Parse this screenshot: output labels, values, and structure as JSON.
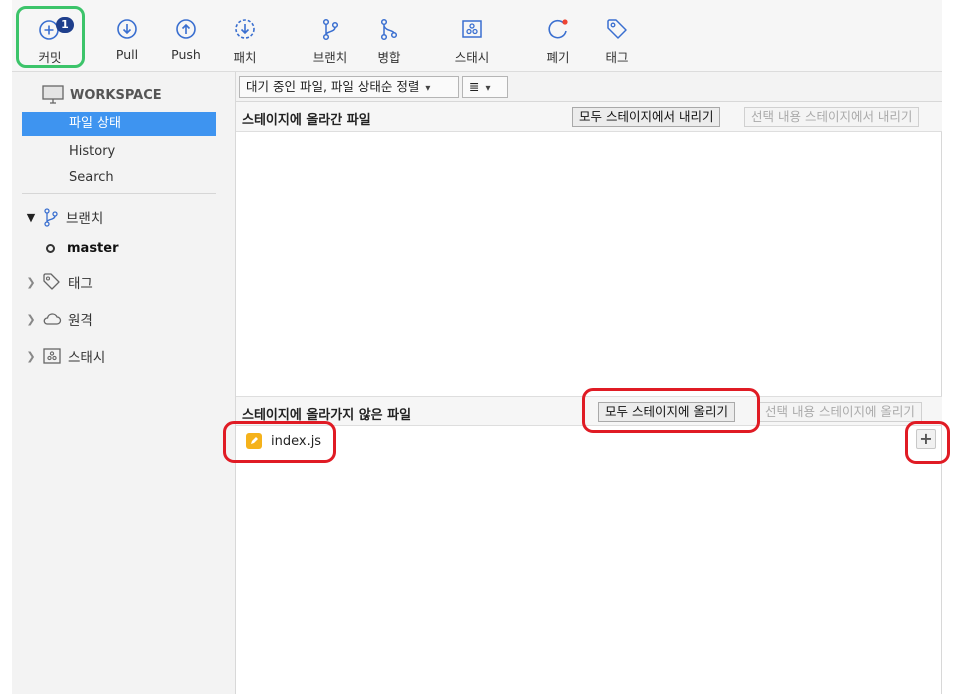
{
  "toolbar": {
    "commit": {
      "label": "커밋",
      "badge": "1"
    },
    "pull": {
      "label": "Pull"
    },
    "push": {
      "label": "Push"
    },
    "patch": {
      "label": "패치"
    },
    "branch": {
      "label": "브랜치"
    },
    "merge": {
      "label": "병합"
    },
    "stash": {
      "label": "스태시"
    },
    "discard": {
      "label": "폐기"
    },
    "tag": {
      "label": "태그"
    }
  },
  "sidebar": {
    "workspace_title": "WORKSPACE",
    "items": [
      {
        "label": "파일 상태",
        "active": true
      },
      {
        "label": "History"
      },
      {
        "label": "Search"
      }
    ],
    "groups": {
      "branches": {
        "label": "브랜치",
        "expanded": true,
        "items": [
          {
            "name": "master",
            "current": true
          }
        ]
      },
      "tags": {
        "label": "태그"
      },
      "remotes": {
        "label": "원격"
      },
      "stashes": {
        "label": "스태시"
      }
    }
  },
  "filterbar": {
    "sort_select": "대기 중인 파일, 파일 상태순 정렬",
    "view_select": "≣"
  },
  "staged": {
    "title": "스테이지에 올라간 파일",
    "unstage_all": "모두 스테이지에서 내리기",
    "unstage_selected": "선택 내용 스테이지에서 내리기",
    "files": []
  },
  "unstaged": {
    "title": "스테이지에 올라가지 않은 파일",
    "stage_all": "모두 스테이지에 올리기",
    "stage_selected": "선택 내용 스테이지에 올리기",
    "files": [
      {
        "name": "index.js",
        "status": "modified",
        "stage_button": "+"
      }
    ]
  },
  "colors": {
    "accent": "#3e94f0",
    "highlight_green": "#3cc46a",
    "highlight_red": "#e01b24",
    "badge": "#1f3f8c",
    "modified_file": "#f5b21b"
  }
}
